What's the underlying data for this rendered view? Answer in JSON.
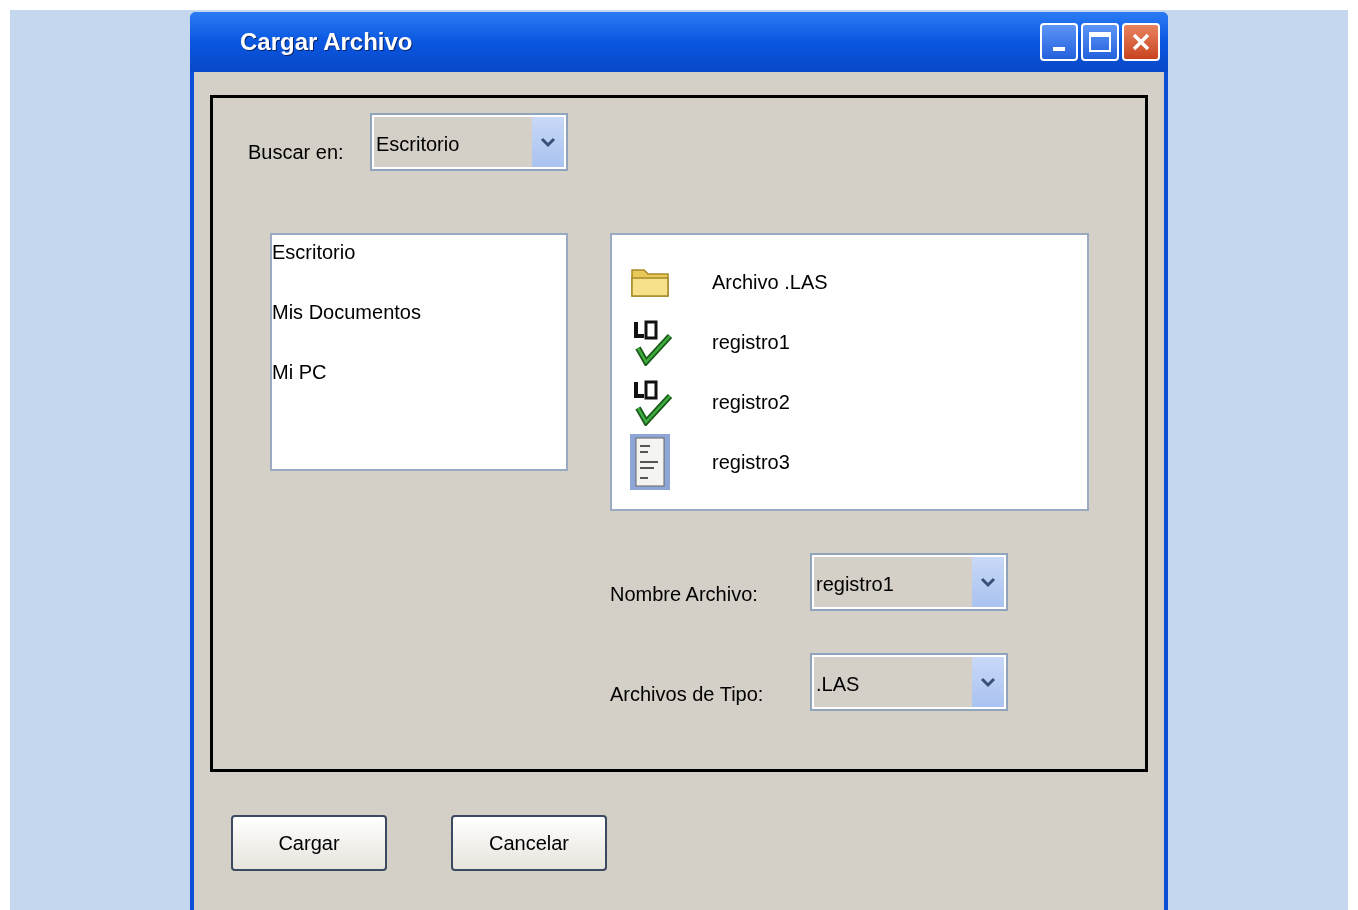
{
  "window": {
    "title": "Cargar Archivo"
  },
  "look_in": {
    "label": "Buscar en:",
    "value": "Escritorio"
  },
  "places": [
    {
      "label": "Escritorio"
    },
    {
      "label": "Mis Documentos"
    },
    {
      "label": "Mi PC"
    }
  ],
  "files": [
    {
      "kind": "folder",
      "name": "Archivo .LAS"
    },
    {
      "kind": "las",
      "name": "registro1"
    },
    {
      "kind": "las",
      "name": "registro2"
    },
    {
      "kind": "document",
      "name": "registro3"
    }
  ],
  "file_name": {
    "label": "Nombre Archivo:",
    "value": "registro1"
  },
  "file_type": {
    "label": "Archivos de Tipo:",
    "value": ".LAS"
  },
  "buttons": [
    "Cargar",
    "Cancelar"
  ]
}
